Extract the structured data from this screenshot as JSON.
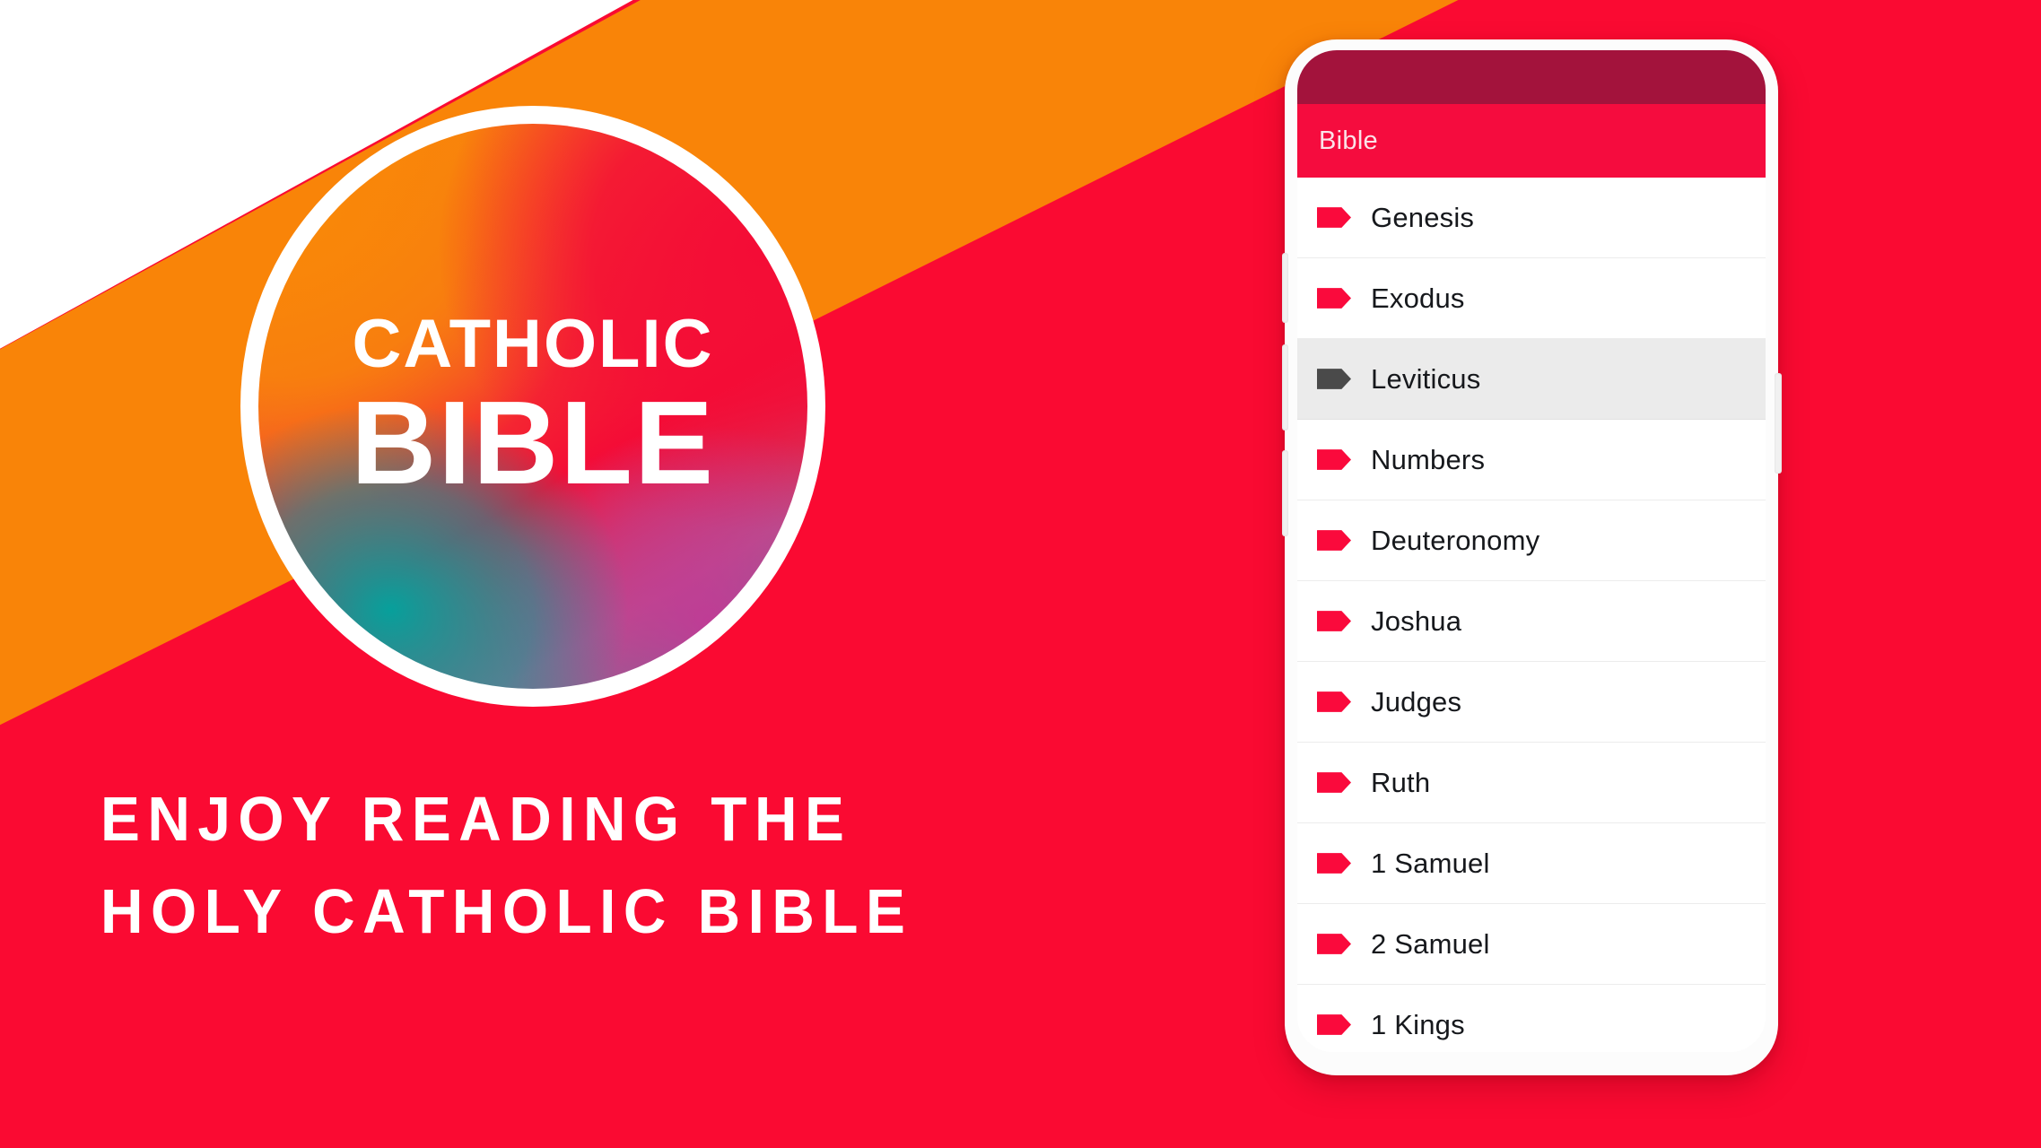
{
  "theme": {
    "background_red": "#FA0A32",
    "band_orange": "#F98408",
    "wedge_white": "#FFFFFF",
    "app_bar_red": "#F50C3E",
    "status_bar_crimson": "#A3133C",
    "tag_icon_red": "#FA0A3C",
    "tag_icon_selected_gray": "#4A4A4A",
    "selected_row_gray": "#EBEBEB"
  },
  "logo": {
    "line1": "CATHOLIC",
    "line2": "BIBLE"
  },
  "tagline": {
    "line1": "ENJOY READING THE",
    "line2": "HOLY CATHOLIC BIBLE"
  },
  "phone": {
    "app_bar": {
      "title": "Bible"
    },
    "book_list": [
      {
        "label": "Genesis",
        "icon": "tag-icon",
        "selected": false
      },
      {
        "label": "Exodus",
        "icon": "tag-icon",
        "selected": false
      },
      {
        "label": "Leviticus",
        "icon": "tag-icon",
        "selected": true
      },
      {
        "label": "Numbers",
        "icon": "tag-icon",
        "selected": false
      },
      {
        "label": "Deuteronomy",
        "icon": "tag-icon",
        "selected": false
      },
      {
        "label": "Joshua",
        "icon": "tag-icon",
        "selected": false
      },
      {
        "label": "Judges",
        "icon": "tag-icon",
        "selected": false
      },
      {
        "label": "Ruth",
        "icon": "tag-icon",
        "selected": false
      },
      {
        "label": "1 Samuel",
        "icon": "tag-icon",
        "selected": false
      },
      {
        "label": "2 Samuel",
        "icon": "tag-icon",
        "selected": false
      },
      {
        "label": "1 Kings",
        "icon": "tag-icon",
        "selected": false
      }
    ],
    "hardware_buttons": [
      {
        "name": "volume-up-button"
      },
      {
        "name": "volume-down-button"
      },
      {
        "name": "mute-switch-button"
      },
      {
        "name": "power-button"
      }
    ]
  }
}
